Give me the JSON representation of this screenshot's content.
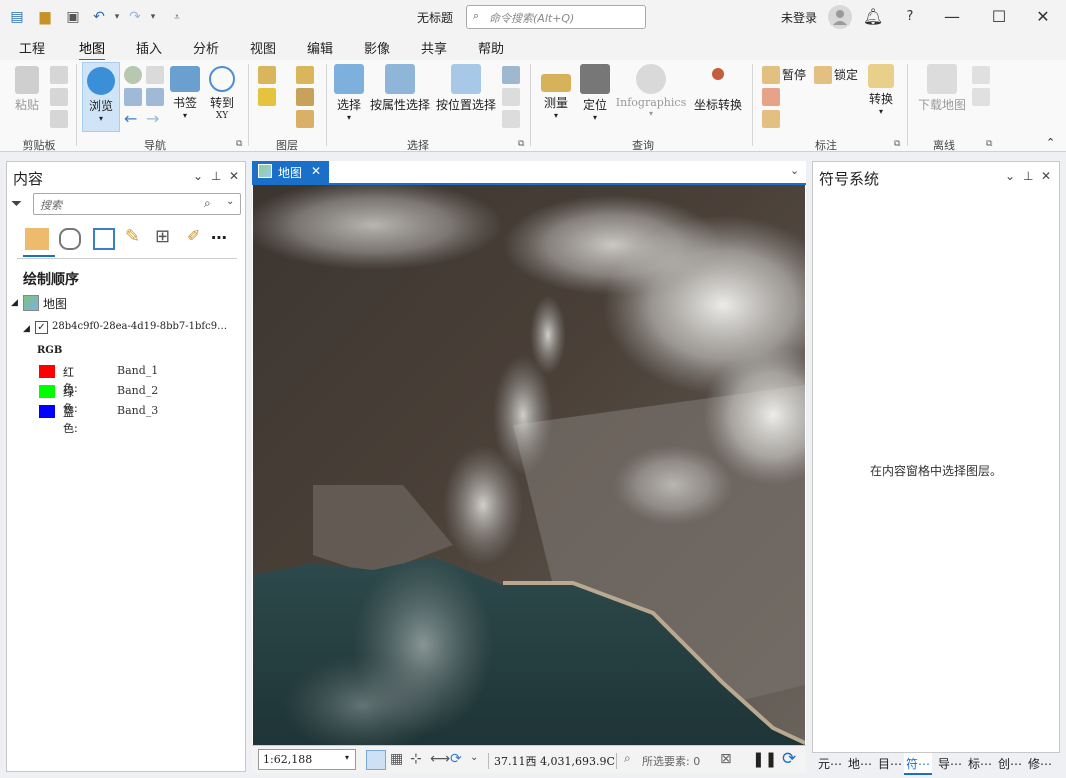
{
  "window": {
    "title": "无标题",
    "search_placeholder": "命令搜索(Alt+Q)",
    "login": "未登录",
    "help": "?"
  },
  "menu": {
    "tabs": [
      "工程",
      "地图",
      "插入",
      "分析",
      "视图",
      "编辑",
      "影像",
      "共享",
      "帮助"
    ],
    "active": "地图"
  },
  "ribbon": {
    "buttons": {
      "paste": "粘贴",
      "explore": "浏览",
      "bookmark": "书签",
      "goto": "转到",
      "goto_sub": "XY",
      "select": "选择",
      "select_by_attr": "按属性选择",
      "select_by_loc": "按位置选择",
      "measure": "测量",
      "locate": "定位",
      "infographics": "Infographics",
      "convert_coords": "坐标转换",
      "pause": "暂停",
      "lock": "锁定",
      "convert": "转换",
      "download_map": "下载地图"
    },
    "groups": [
      "剪贴板",
      "导航",
      "图层",
      "选择",
      "查询",
      "标注",
      "离线"
    ]
  },
  "contents_pane": {
    "title": "内容",
    "search_placeholder": "搜索",
    "draw_order": "绘制顺序",
    "map_node": "地图",
    "layer_name": "28b4c9f0-28ea-4d19-8bb7-1bfc9…",
    "rgb_label": "RGB",
    "bands": [
      {
        "channel": "红色:",
        "band": "Band_1",
        "color": "#ff0000"
      },
      {
        "channel": "绿色:",
        "band": "Band_2",
        "color": "#00ff00"
      },
      {
        "channel": "蓝色:",
        "band": "Band_3",
        "color": "#0000ff"
      }
    ]
  },
  "map_view": {
    "tab_label": "地图",
    "scale": "1:62,188",
    "coords": "37.11西 4,031,693.9C",
    "selected_features": "所选要素: 0"
  },
  "symbology_pane": {
    "title": "符号系统",
    "message": "在内容窗格中选择图层。",
    "bottom_tabs": [
      "元⋯",
      "地⋯",
      "目⋯",
      "符⋯",
      "导⋯",
      "标⋯",
      "创⋯",
      "修⋯"
    ],
    "active_tab": "符⋯"
  }
}
